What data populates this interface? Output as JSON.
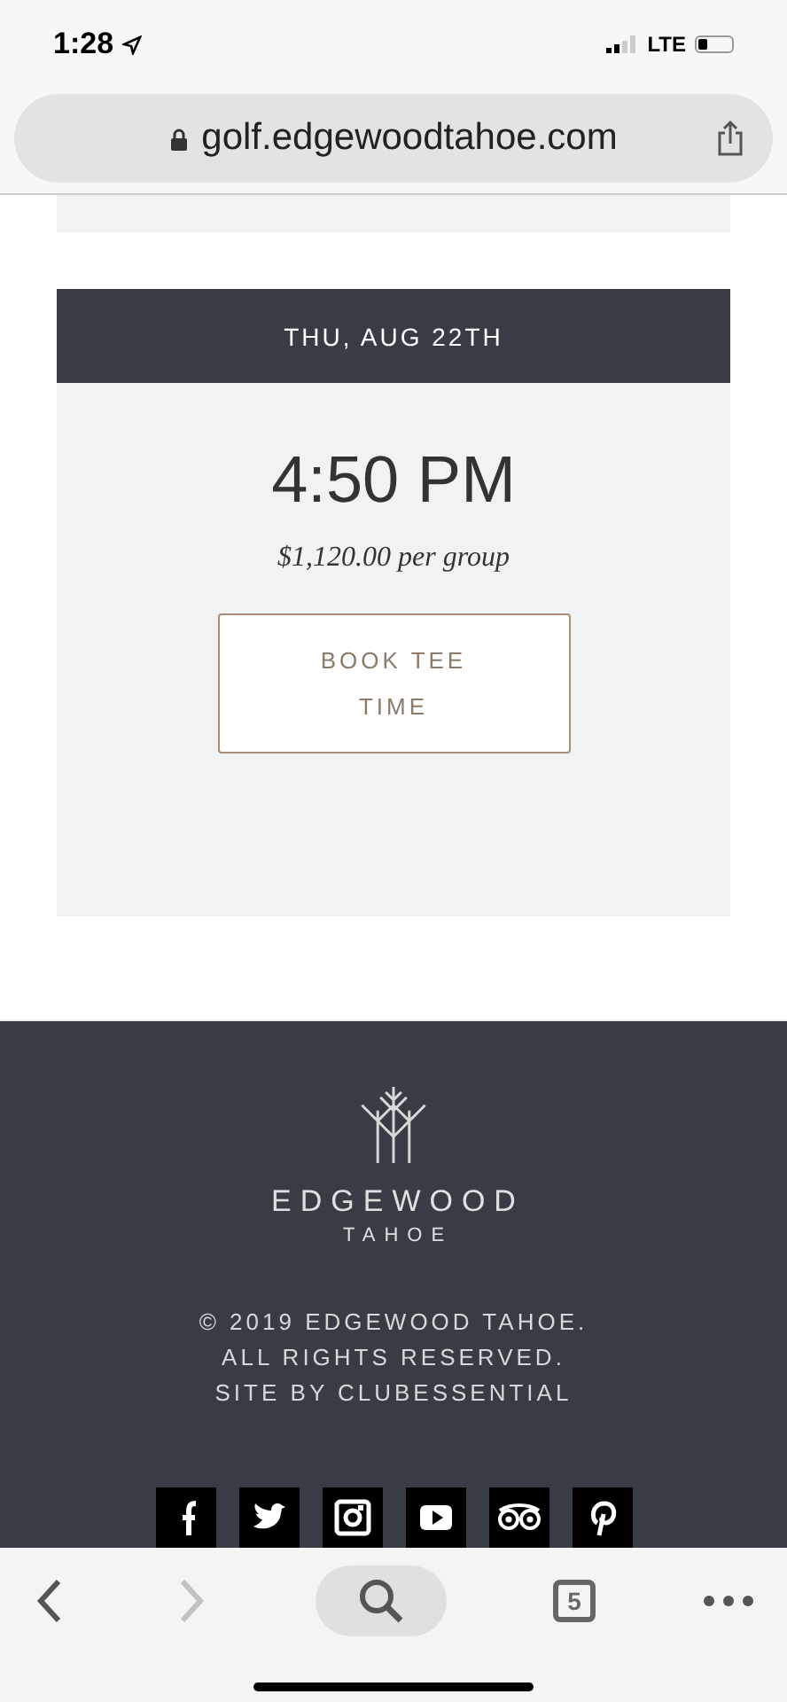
{
  "status_bar": {
    "time": "1:28",
    "network": "LTE"
  },
  "address_bar": {
    "url": "golf.edgewoodtahoe.com"
  },
  "tee_time": {
    "date": "THU, AUG 22TH",
    "time": "4:50 PM",
    "price": "$1,120.00 per group",
    "button": "BOOK TEE TIME"
  },
  "footer": {
    "brand": "EDGEWOOD",
    "sub_brand": "TAHOE",
    "lines": [
      "© 2019 EDGEWOOD TAHOE.",
      "ALL RIGHTS RESERVED.",
      "SITE BY CLUBESSENTIAL"
    ],
    "social": [
      {
        "kind": "facebook"
      },
      {
        "kind": "twitter"
      },
      {
        "kind": "instagram"
      },
      {
        "kind": "youtube"
      },
      {
        "kind": "tripadvisor"
      },
      {
        "kind": "pinterest"
      }
    ]
  },
  "toolbar": {
    "back": {
      "disabled": false
    },
    "forward": {
      "disabled": true
    },
    "tab_count": "5"
  }
}
